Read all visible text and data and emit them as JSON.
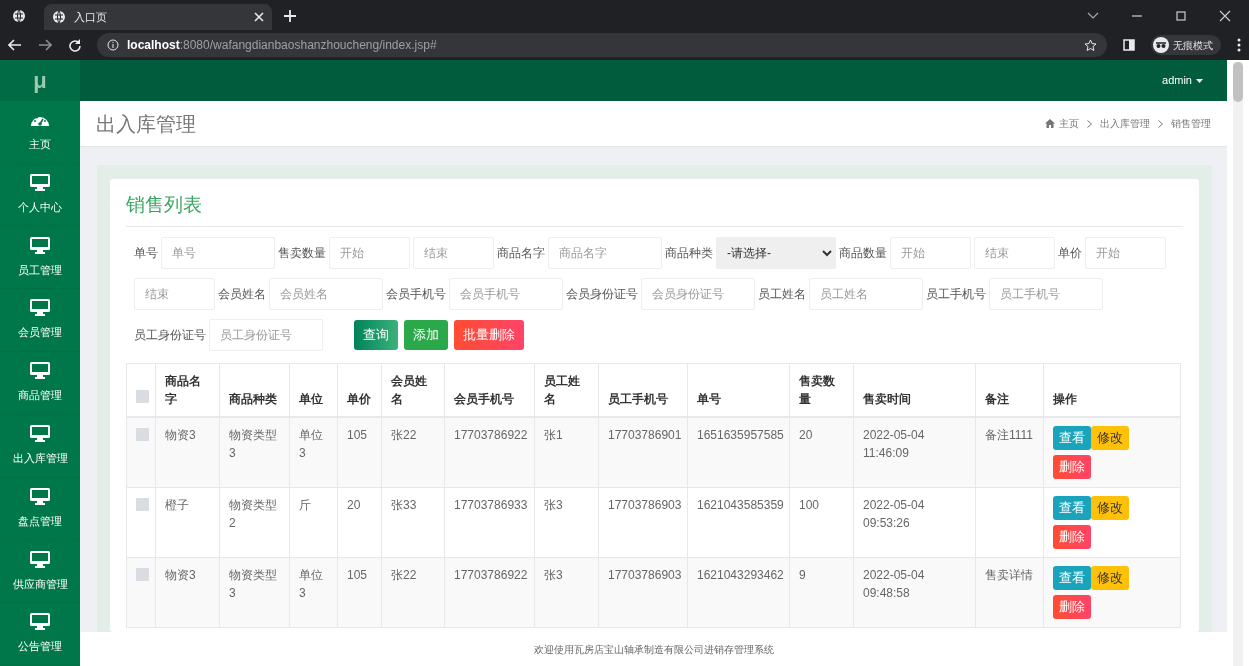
{
  "browser": {
    "tabs": [
      {
        "title": "入口页",
        "selected": true
      }
    ],
    "url_host": "localhost",
    "url_path": ":8080/wafangdianbaoshanzhoucheng/index.jsp#",
    "profile": "无痕模式"
  },
  "app": {
    "logo": "μ",
    "user": "admin"
  },
  "sidebar": {
    "items": [
      {
        "label": "主页",
        "kind": "dashboard"
      },
      {
        "label": "个人中心",
        "kind": "monitor"
      },
      {
        "label": "员工管理",
        "kind": "monitor"
      },
      {
        "label": "会员管理",
        "kind": "monitor"
      },
      {
        "label": "商品管理",
        "kind": "monitor"
      },
      {
        "label": "出入库管理",
        "kind": "monitor"
      },
      {
        "label": "盘点管理",
        "kind": "monitor"
      },
      {
        "label": "供应商管理",
        "kind": "monitor"
      },
      {
        "label": "公告管理",
        "kind": "monitor"
      }
    ]
  },
  "page_header": {
    "title": "出入库管理",
    "breadcrumb": [
      "主页",
      "出入库管理",
      "销售管理"
    ]
  },
  "card": {
    "title": "销售列表",
    "filters": [
      {
        "kind": "label",
        "text": "单号"
      },
      {
        "kind": "input",
        "placeholder": "单号"
      },
      {
        "kind": "label",
        "text": "售卖数量"
      },
      {
        "kind": "short-input",
        "placeholder": "开始"
      },
      {
        "kind": "short-input",
        "placeholder": "结束"
      },
      {
        "kind": "label",
        "text": "商品名字"
      },
      {
        "kind": "input",
        "placeholder": "商品名字"
      },
      {
        "kind": "label",
        "text": "商品种类"
      },
      {
        "kind": "select",
        "value": "-请选择-"
      },
      {
        "kind": "label",
        "text": "商品数量"
      },
      {
        "kind": "short-input",
        "placeholder": "开始"
      },
      {
        "kind": "short-input",
        "placeholder": "结束"
      },
      {
        "kind": "label",
        "text": "单价"
      },
      {
        "kind": "short-input",
        "placeholder": "开始"
      },
      {
        "kind": "short-input",
        "placeholder": "结束"
      },
      {
        "kind": "label",
        "text": "会员姓名"
      },
      {
        "kind": "input",
        "placeholder": "会员姓名"
      },
      {
        "kind": "label",
        "text": "会员手机号"
      },
      {
        "kind": "input",
        "placeholder": "会员手机号"
      },
      {
        "kind": "label",
        "text": "会员身份证号"
      },
      {
        "kind": "input",
        "placeholder": "会员身份证号"
      },
      {
        "kind": "label",
        "text": "员工姓名"
      },
      {
        "kind": "input",
        "placeholder": "员工姓名"
      },
      {
        "kind": "label",
        "text": "员工手机号"
      },
      {
        "kind": "input",
        "placeholder": "员工手机号"
      },
      {
        "kind": "label",
        "text": "员工身份证号"
      },
      {
        "kind": "input",
        "placeholder": "员工身份证号"
      }
    ],
    "buttons": [
      {
        "label": "查询",
        "kind": "search"
      },
      {
        "label": "添加",
        "kind": "add"
      },
      {
        "label": "批量删除",
        "kind": "delete"
      }
    ]
  },
  "table": {
    "header_checked": false,
    "columns": [
      "商品名字",
      "商品种类",
      "单位",
      "单价",
      "会员姓名",
      "会员手机号",
      "员工姓名",
      "员工手机号",
      "单号",
      "售卖数量",
      "售卖时间",
      "备注",
      "操作"
    ],
    "rows": [
      {
        "checked": false,
        "cells": [
          "物资3",
          "物资类型3",
          "单位3",
          "105",
          "张22",
          "17703786922",
          "张1",
          "17703786901",
          "1651635957585",
          "20",
          "2022-05-04 11:46:09",
          "备注1111"
        ],
        "actions": [
          {
            "label": "查看",
            "kind": "view"
          },
          {
            "label": "修改",
            "kind": "edit"
          },
          {
            "label": "删除",
            "kind": "delete"
          }
        ]
      },
      {
        "checked": false,
        "cells": [
          "橙子",
          "物资类型2",
          "斤",
          "20",
          "张33",
          "17703786933",
          "张3",
          "17703786903",
          "1621043585359",
          "100",
          "2022-05-04 09:53:26",
          ""
        ],
        "actions": [
          {
            "label": "查看",
            "kind": "view"
          },
          {
            "label": "修改",
            "kind": "edit"
          },
          {
            "label": "删除",
            "kind": "delete"
          }
        ]
      },
      {
        "checked": false,
        "cells": [
          "物资3",
          "物资类型3",
          "单位3",
          "105",
          "张22",
          "17703786922",
          "张3",
          "17703786903",
          "1621043293462",
          "9",
          "2022-05-04 09:48:58",
          "售卖详情"
        ],
        "actions": [
          {
            "label": "查看",
            "kind": "view"
          },
          {
            "label": "修改",
            "kind": "edit"
          },
          {
            "label": "删除",
            "kind": "delete"
          }
        ]
      }
    ]
  },
  "footer": "欢迎使用瓦房店宝山轴承制造有限公司进销存管理系统"
}
